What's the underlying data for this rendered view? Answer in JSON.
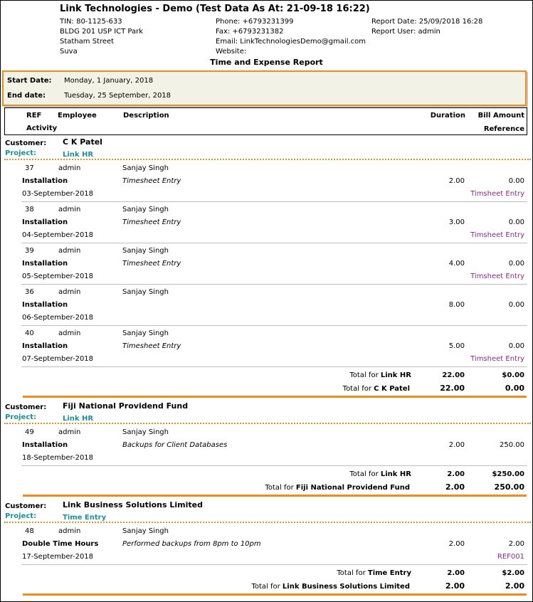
{
  "company": {
    "title": "Link Technologies - Demo (Test Data As At: 21-09-18 16:22)",
    "tin": "TIN: 80-1125-633",
    "address1": "BLDG 201 USP ICT Park",
    "address2": "Statham Street",
    "city": "Suva",
    "phone": "Phone: +6793231399",
    "fax": "Fax: +6793231382",
    "email": "Email: LinkTechnologiesDemo@gmail.com",
    "website": "Website:",
    "report_date": "Report Date: 25/09/2018 16:28",
    "report_user": "Report User: admin"
  },
  "report_title": "Time and Expense Report",
  "filters": {
    "start_label": "Start Date:",
    "start_value": "Monday, 1 January, 2018",
    "end_label": "End date:",
    "end_value": "Tuesday, 25 September, 2018"
  },
  "columns": {
    "ref": "REF",
    "employee": "Employee",
    "description": "Description",
    "duration": "Duration",
    "bill_amount": "Bill Amount",
    "activity": "Activity",
    "reference": "Reference"
  },
  "labels": {
    "customer": "Customer:",
    "project": "Project:",
    "total_for": "Total for"
  },
  "groups": [
    {
      "customer": "C K Patel",
      "project": "Link HR",
      "entries": [
        {
          "ref": "37",
          "employee": "admin",
          "desc": "Sanjay Singh",
          "activity": "Installation",
          "note": "Timesheet Entry",
          "date": "03-September-2018",
          "duration": "2.00",
          "amount": "0.00",
          "reference": "Timsheet Entry"
        },
        {
          "ref": "38",
          "employee": "admin",
          "desc": "Sanjay Singh",
          "activity": "Installation",
          "note": "Timesheet Entry",
          "date": "04-September-2018",
          "duration": "3.00",
          "amount": "0.00",
          "reference": "Timsheet Entry"
        },
        {
          "ref": "39",
          "employee": "admin",
          "desc": "Sanjay Singh",
          "activity": "Installation",
          "note": "Timesheet Entry",
          "date": "05-September-2018",
          "duration": "4.00",
          "amount": "0.00",
          "reference": "Timsheet Entry"
        },
        {
          "ref": "36",
          "employee": "admin",
          "desc": "Sanjay Singh",
          "activity": "Installation",
          "note": "",
          "date": "06-September-2018",
          "duration": "8.00",
          "amount": "0.00",
          "reference": ""
        },
        {
          "ref": "40",
          "employee": "admin",
          "desc": "Sanjay Singh",
          "activity": "Installation",
          "note": "Timesheet Entry",
          "date": "07-September-2018",
          "duration": "5.00",
          "amount": "0.00",
          "reference": "Timsheet Entry"
        }
      ],
      "project_total": {
        "name": "Link HR",
        "duration": "22.00",
        "amount": "$0.00"
      },
      "customer_total": {
        "name": "C K Patel",
        "duration": "22.00",
        "amount": "0.00"
      }
    },
    {
      "customer": "Fiji National Providend Fund",
      "project": "Link HR",
      "entries": [
        {
          "ref": "49",
          "employee": "admin",
          "desc": "Sanjay Singh",
          "activity": "Installation",
          "note": "Backups for Client Databases",
          "date": "18-September-2018",
          "duration": "2.00",
          "amount": "250.00",
          "reference": ""
        }
      ],
      "project_total": {
        "name": "Link HR",
        "duration": "2.00",
        "amount": "$250.00"
      },
      "customer_total": {
        "name": "Fiji National Providend Fund",
        "duration": "2.00",
        "amount": "250.00"
      }
    },
    {
      "customer": "Link Business Solutions Limited",
      "project": "Time Entry",
      "entries": [
        {
          "ref": "48",
          "employee": "admin",
          "desc": "Sanjay Singh",
          "activity": "Double Time Hours",
          "note": "Performed backups from 8pm to 10pm",
          "date": "17-September-2018",
          "duration": "2.00",
          "amount": "2.00",
          "reference": "REF001"
        }
      ],
      "project_total": {
        "name": "Time Entry",
        "duration": "2.00",
        "amount": "$2.00"
      },
      "customer_total": {
        "name": "Link Business Solutions Limited",
        "duration": "2.00",
        "amount": "2.00"
      }
    }
  ]
}
